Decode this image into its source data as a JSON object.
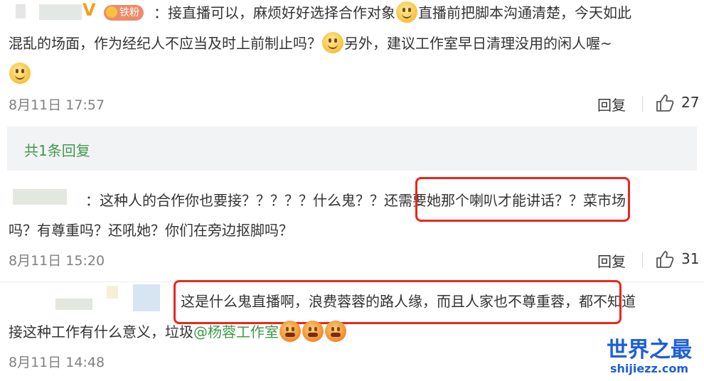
{
  "comments": [
    {
      "username_suffix": "V",
      "badge": "铁粉",
      "text_line1_a": "：接直播可以，麻烦好好选择合作对象",
      "text_line1_b": "直播前把脚本沟通清楚，今天如此",
      "text_line2_a": "混乱的场面，作为经纪人不应当及时上前制止吗？",
      "text_line2_b": "另外，建议工作室早日清理没用的闲人喔~",
      "time": "8月11日 17:57",
      "reply_label": "回复",
      "likes": "27"
    },
    {
      "text_line1_a": "：这种人的合作你也要接？？？？？什么鬼？？",
      "text_line1_highlight": "还需要她那个喇叭才能讲话？",
      "text_line1_b": "？菜市场",
      "text_line2": "吗？有尊重吗？还吼她？你们在旁边抠脚吗？",
      "time": "8月11日 15:20",
      "reply_label": "回复",
      "likes": "31"
    },
    {
      "text_line1_highlight": "这是什么鬼直播啊，浪费蓉蓉的路人缘，而且人家也不尊重蓉",
      "text_line1_b": "，都不知道",
      "text_line2_a": "接这种工作有什么意义，垃圾",
      "mention": "@杨蓉工作室",
      "time": "8月11日 14:48"
    }
  ],
  "reply_summary": "共1条回复",
  "watermark": {
    "title": "世界之最",
    "url": "shijiezz.com"
  },
  "colors": {
    "highlight_border": "#e8281f",
    "link_green": "#3f9a4b",
    "meta_gray": "#808080",
    "reply_box_bg": "#f2f3f5"
  },
  "icons": [
    "smile-emoji-icon",
    "angry-emoji-icon",
    "thumbs-up-icon",
    "crown-badge-icon"
  ]
}
